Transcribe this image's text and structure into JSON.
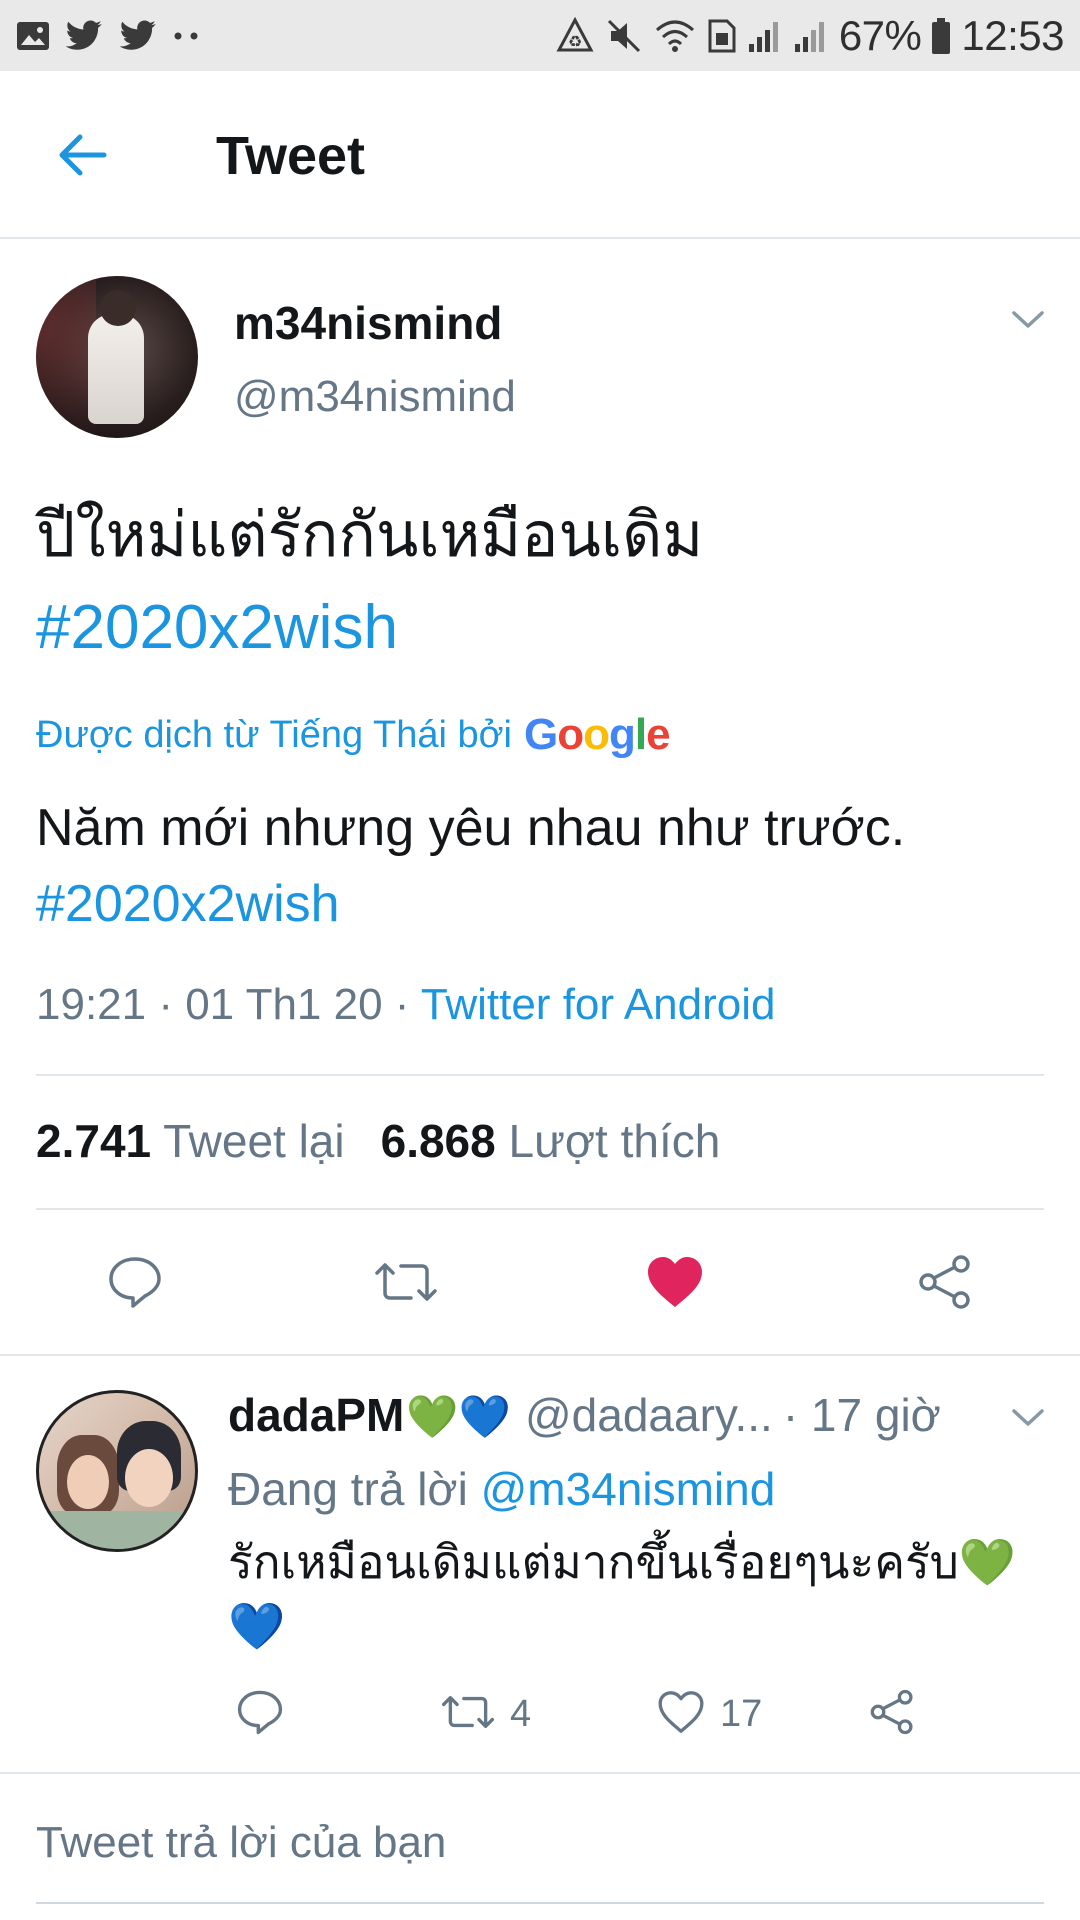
{
  "status_bar": {
    "battery_percent": "67%",
    "time": "12:53",
    "left_icons": [
      "image-icon",
      "twitter-bird-icon",
      "twitter-bird-icon",
      "more-dots-icon"
    ],
    "right_icons": [
      "recycle-icon",
      "mute-icon",
      "wifi-icon",
      "sim-icon",
      "signal-icon",
      "signal-icon",
      "battery-icon"
    ]
  },
  "header": {
    "title": "Tweet"
  },
  "tweet": {
    "author_name": "m34nismind",
    "author_handle": "@m34nismind",
    "text": "ปีใหม่แต่รักกันเหมือนเดิม",
    "hashtag": "#2020x2wish",
    "translated_label": "Được dịch từ Tiếng Thái bởi",
    "translated_provider": "Google",
    "translation_text": "Năm mới nhưng yêu nhau như trước.",
    "translation_hashtag": "#2020x2wish",
    "timestamp": "19:21 · 01 Th1 20 ·",
    "source": "Twitter for Android",
    "retweets_count": "2.741",
    "retweets_label": "Tweet lại",
    "likes_count": "6.868",
    "likes_label": "Lượt thích",
    "liked": true,
    "colors": {
      "accent": "#1b95e0",
      "like": "#e0245e",
      "muted": "#657786"
    }
  },
  "reply": {
    "author_name": "dadaPM",
    "name_emoji": "💚💙",
    "author_handle": "@dadaary...",
    "time": "· 17 giờ",
    "replying_label": "Đang trả lời",
    "replying_to": "@m34nismind",
    "text": "รักเหมือนเดิมแต่มากขึ้นเรื่อยๆนะครับ",
    "text_emoji_green": "💚",
    "text_emoji_blue": "💙",
    "retweet_count": "4",
    "like_count": "17"
  },
  "composer": {
    "placeholder": "Tweet trả lời của bạn"
  }
}
